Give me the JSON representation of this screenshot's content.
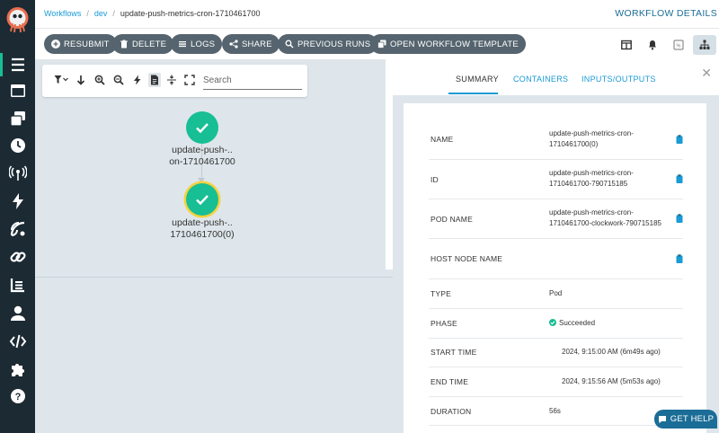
{
  "breadcrumb": {
    "workflows": "Workflows",
    "namespace": "dev",
    "workflow": "update-push-metrics-cron-1710461700"
  },
  "page_title": "WORKFLOW DETAILS",
  "toolbar": {
    "resubmit": "RESUBMIT",
    "delete": "DELETE",
    "logs": "LOGS",
    "share": "SHARE",
    "previous_runs": "PREVIOUS RUNS",
    "open_template": "OPEN WORKFLOW TEMPLATE"
  },
  "graph": {
    "search_placeholder": "Search",
    "nodes": [
      {
        "label_line1": "update-push-..",
        "label_line2": "on-1710461700",
        "status": "succeeded"
      },
      {
        "label_line1": "update-push-..",
        "label_line2": "1710461700(0)",
        "status": "succeeded"
      }
    ]
  },
  "details": {
    "tabs": [
      "SUMMARY",
      "CONTAINERS",
      "INPUTS/OUTPUTS"
    ],
    "active_tab": "SUMMARY",
    "rows": [
      {
        "label": "NAME",
        "value1": "update-push-metrics-cron-",
        "value2": "1710461700(0)"
      },
      {
        "label": "ID",
        "value1": "update-push-metrics-cron-",
        "value2": "1710461700-790715185"
      },
      {
        "label": "POD NAME",
        "value1": "update-push-metrics-cron-",
        "value2": "1710461700-clockwork-790715185"
      },
      {
        "label": "HOST NODE NAME",
        "value1": "",
        "value2": ""
      },
      {
        "label": "TYPE",
        "value1": "Pod",
        "value2": ""
      },
      {
        "label": "PHASE",
        "value1": "Succeeded",
        "value2": ""
      },
      {
        "label": "START TIME",
        "value1": "2024, 9:15:00 AM (6m49s ago)",
        "value2": ""
      },
      {
        "label": "END TIME",
        "value1": "2024, 9:15:56 AM (5m53s ago)",
        "value2": ""
      },
      {
        "label": "DURATION",
        "value1": "56s",
        "value2": ""
      }
    ]
  },
  "get_help": "GET HELP",
  "colors": {
    "sidebar": "#1b2a33",
    "success": "#18be94",
    "link": "#1a9ad6",
    "button": "#55646e"
  }
}
